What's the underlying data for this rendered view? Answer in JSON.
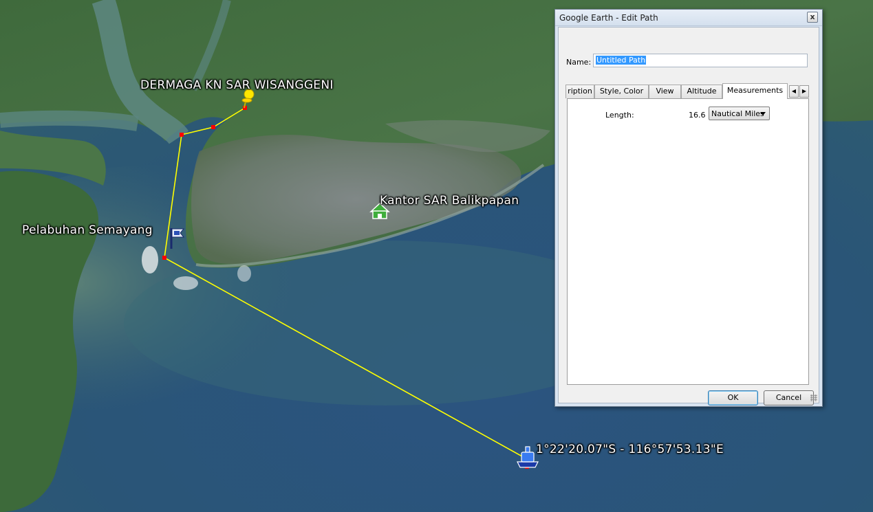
{
  "map": {
    "labels": {
      "dermaga": "DERMAGA KN SAR WISANGGENI",
      "kantor": "Kantor SAR Balikpapan",
      "pelabuhan": "Pelabuhan Semayang",
      "coordinate": "1°22'20.07\"S - 116°57'53.13\"E"
    },
    "icons": {
      "dermaga": "yellow-pushpin-icon",
      "kantor": "green-house-icon",
      "pelabuhan": "flag-icon",
      "coordinate": "ship-icon"
    },
    "path_color": "#ffff00",
    "vertex_color": "#ff0000"
  },
  "dialog": {
    "title": "Google Earth - Edit Path",
    "close_glyph": "x",
    "name_label": "Name:",
    "name_value": "Untitled Path",
    "tabs": [
      {
        "label": "ription",
        "active": false
      },
      {
        "label": "Style, Color",
        "active": false
      },
      {
        "label": "View",
        "active": false
      },
      {
        "label": "Altitude",
        "active": false
      },
      {
        "label": "Measurements",
        "active": true
      }
    ],
    "tab_scroll_left": "◀",
    "tab_scroll_right": "▶",
    "measurements": {
      "length_label": "Length:",
      "length_value": "16.6",
      "units_selected": "Nautical Miles"
    },
    "ok_label": "OK",
    "cancel_label": "Cancel"
  }
}
